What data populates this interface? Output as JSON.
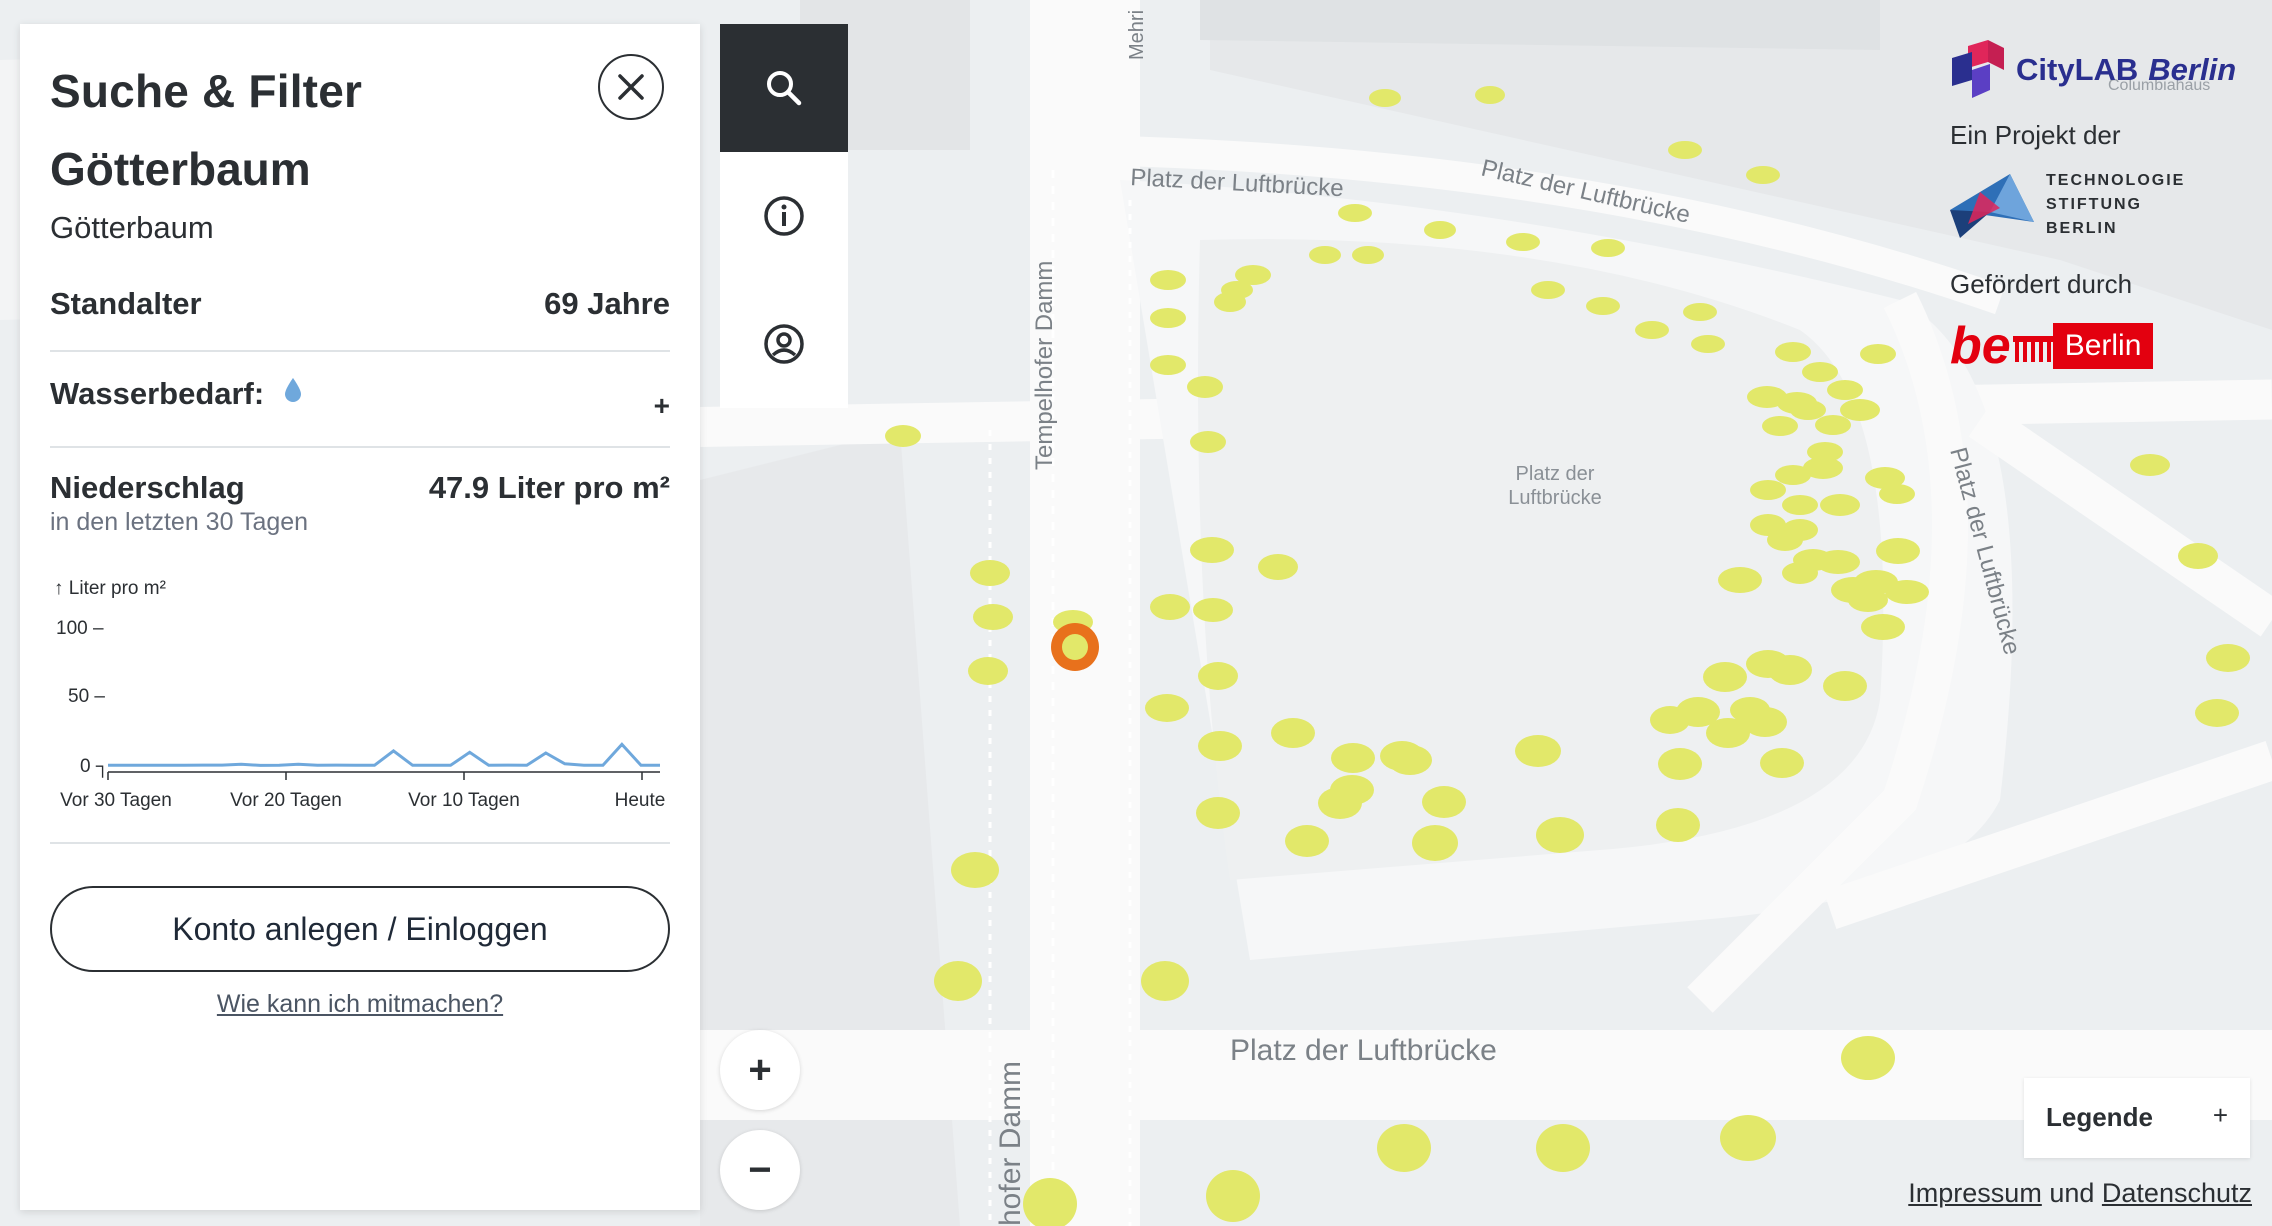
{
  "panel": {
    "title": "Suche & Filter",
    "tree_name": "Götterbaum",
    "tree_species": "Götterbaum",
    "age_label": "Standalter",
    "age_value": "69 Jahre",
    "water_label": "Wasserbedarf:",
    "water_expand": "+",
    "rain_label": "Niederschlag",
    "rain_value": "47.9 Liter pro m²",
    "rain_sub": "in den letzten 30 Tagen",
    "account_button": "Konto anlegen / Einloggen",
    "participate_link": "Wie kann ich mitmachen?"
  },
  "chart_data": {
    "type": "line",
    "ylabel": "↑ Liter pro m²",
    "ylim": [
      0,
      100
    ],
    "yticks": [
      "100 –",
      "50 –",
      "0 ┐"
    ],
    "xticks": [
      "Vor 30 Tagen",
      "Vor 20 Tagen",
      "Vor 10 Tagen",
      "Heute"
    ],
    "color": "#6fa8dc",
    "values": [
      0.5,
      0.5,
      0.5,
      0.5,
      0.5,
      0.6,
      0.6,
      1.2,
      0.4,
      0.5,
      1.2,
      0.5,
      0.6,
      0.5,
      0.5,
      10.5,
      0.5,
      0.5,
      0.5,
      9.5,
      0.5,
      0.6,
      0.5,
      9,
      1.5,
      0.5,
      0.5,
      15,
      0.5,
      0.5
    ]
  },
  "toolbar": {
    "items": [
      "search-icon",
      "info-icon",
      "user-icon"
    ]
  },
  "zoom": {
    "in": "+",
    "out": "−"
  },
  "branding": {
    "citylab": "CityLAB",
    "berlin": "Berlin",
    "project_by": "Ein Projekt der",
    "tsb_lines": [
      "TECHNOLOGIE",
      "STIFTUNG",
      "BERLIN"
    ],
    "funded_by": "Gefördert durch",
    "be_berlin_text": "Berlin"
  },
  "legend": {
    "label": "Legende",
    "expand": "+"
  },
  "footer": {
    "impressum": "Impressum",
    "und": "und",
    "datenschutz": "Datenschutz"
  },
  "map_labels": {
    "street1": "Platz der Luftbrücke",
    "street2": "Platz der Luftbrücke",
    "street3": "Platz der Luftbrücke",
    "street4": "Platz der Luftbrücke",
    "square": "Platz der",
    "square2": "Luftbrücke",
    "damm1": "Tempelhofer Damm",
    "damm2": "hofer Damm",
    "mehring": "Mehri",
    "columbia": "Columbiahaus"
  },
  "colors": {
    "tree": "#e2e86a",
    "selected": "#e8711c",
    "water": "#6fa8dc",
    "dark": "#2b2f33"
  }
}
